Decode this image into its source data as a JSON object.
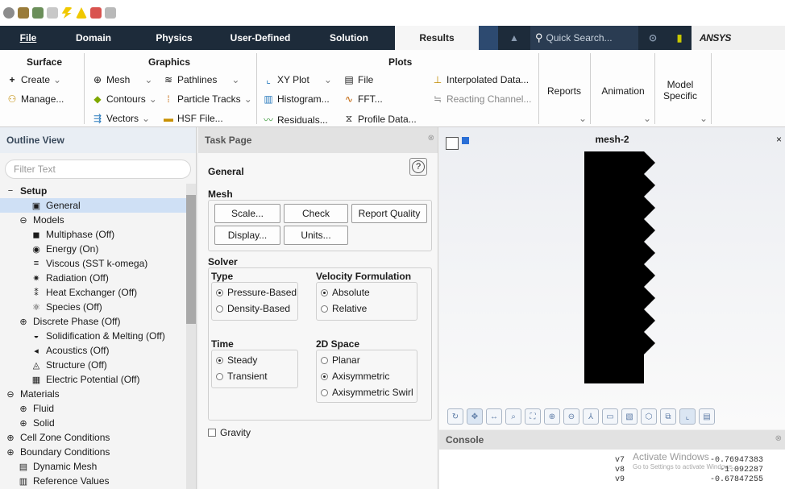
{
  "quick_access": {
    "icons": [
      "gear-icon",
      "cube-icon",
      "cube-icon",
      "infinity-icon",
      "lightning-icon",
      "ansys-logo-icon",
      "mesh-icon",
      "grid-icon"
    ]
  },
  "menubar": {
    "tabs": [
      "File",
      "Domain",
      "Physics",
      "User-Defined",
      "Solution",
      "Results"
    ],
    "active": "Results",
    "search_placeholder": "Quick Search...",
    "brand": "ANSYS"
  },
  "ribbon": {
    "surface": {
      "title": "Surface",
      "create": "Create",
      "manage": "Manage..."
    },
    "graphics": {
      "title": "Graphics",
      "mesh": "Mesh",
      "pathlines": "Pathlines",
      "contours": "Contours",
      "particle_tracks": "Particle Tracks",
      "vectors": "Vectors",
      "hsf_file": "HSF File..."
    },
    "plots": {
      "title": "Plots",
      "xy_plot": "XY Plot",
      "file": "File",
      "histogram": "Histogram...",
      "fft": "FFT...",
      "residuals": "Residuals...",
      "profile_data": "Profile Data...",
      "interpolated_data": "Interpolated Data...",
      "reacting_channel": "Reacting Channel..."
    },
    "reports": "Reports",
    "animation": "Animation",
    "model_specific": "Model Specific"
  },
  "outline": {
    "title": "Outline View",
    "filter_placeholder": "Filter Text",
    "items": [
      {
        "label": "Setup",
        "icon": "expand-icon",
        "level": 0,
        "bold": true
      },
      {
        "label": "General",
        "icon": "general-icon",
        "level": 2,
        "selected": true
      },
      {
        "label": "Models",
        "icon": "models-icon",
        "level": 1
      },
      {
        "label": "Multiphase (Off)",
        "icon": "multiphase-icon",
        "level": 2
      },
      {
        "label": "Energy (On)",
        "icon": "energy-icon",
        "level": 2
      },
      {
        "label": "Viscous (SST k-omega)",
        "icon": "viscous-icon",
        "level": 2
      },
      {
        "label": "Radiation (Off)",
        "icon": "radiation-icon",
        "level": 2
      },
      {
        "label": "Heat Exchanger (Off)",
        "icon": "heat-exchanger-icon",
        "level": 2
      },
      {
        "label": "Species (Off)",
        "icon": "species-icon",
        "level": 2
      },
      {
        "label": "Discrete Phase (Off)",
        "icon": "discrete-phase-icon",
        "level": 1
      },
      {
        "label": "Solidification & Melting (Off)",
        "icon": "solidification-icon",
        "level": 2
      },
      {
        "label": "Acoustics (Off)",
        "icon": "acoustics-icon",
        "level": 2
      },
      {
        "label": "Structure (Off)",
        "icon": "structure-icon",
        "level": 2
      },
      {
        "label": "Electric Potential (Off)",
        "icon": "electric-potential-icon",
        "level": 2
      },
      {
        "label": "Materials",
        "icon": "materials-icon",
        "level": 0
      },
      {
        "label": "Fluid",
        "icon": "fluid-icon",
        "level": 1
      },
      {
        "label": "Solid",
        "icon": "solid-icon",
        "level": 1
      },
      {
        "label": "Cell Zone Conditions",
        "icon": "cell-zone-icon",
        "level": 0
      },
      {
        "label": "Boundary Conditions",
        "icon": "boundary-icon",
        "level": 0
      },
      {
        "label": "Dynamic Mesh",
        "icon": "dynamic-mesh-icon",
        "level": 1
      },
      {
        "label": "Reference Values",
        "icon": "reference-values-icon",
        "level": 1
      }
    ]
  },
  "task": {
    "title": "Task Page",
    "heading": "General",
    "mesh": {
      "title": "Mesh",
      "scale": "Scale...",
      "check": "Check",
      "report_quality": "Report Quality",
      "display": "Display...",
      "units": "Units..."
    },
    "solver": {
      "title": "Solver",
      "type_title": "Type",
      "type_options": [
        "Pressure-Based",
        "Density-Based"
      ],
      "type_selected": "Pressure-Based",
      "velocity_title": "Velocity Formulation",
      "velocity_options": [
        "Absolute",
        "Relative"
      ],
      "velocity_selected": "Absolute",
      "time_title": "Time",
      "time_options": [
        "Steady",
        "Transient"
      ],
      "time_selected": "Steady",
      "space_title": "2D Space",
      "space_options": [
        "Planar",
        "Axisymmetric",
        "Axisymmetric Swirl"
      ],
      "space_selected": "Axisymmetric"
    },
    "gravity": "Gravity"
  },
  "graphics": {
    "title": "mesh-2"
  },
  "console": {
    "title": "Console",
    "lines": [
      {
        "k": "v7",
        "v": "-0.76947383"
      },
      {
        "k": "v8",
        "v": "-1.092287"
      },
      {
        "k": "v9",
        "v": "-0.67847255"
      }
    ],
    "watermark_1": "Activate Windows",
    "watermark_2": "Go to Settings to activate Windows."
  }
}
